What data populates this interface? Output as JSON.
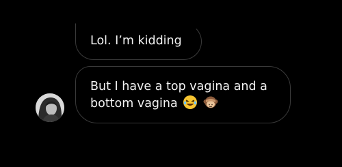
{
  "conversation": {
    "messages": [
      {
        "text": "Lol. I’m kidding"
      },
      {
        "line1": "But I have a top vagina and a",
        "line2": "bottom vagina",
        "emojis": [
          "laughing-with-tears-emoji",
          "see-no-evil-monkey-emoji"
        ]
      }
    ]
  },
  "colors": {
    "background": "#000000",
    "bubble_border": "#3a3a3a",
    "text": "#f2f2f2",
    "emoji_yellow": "#f7c531",
    "monkey_brown": "#8a5a3b"
  }
}
